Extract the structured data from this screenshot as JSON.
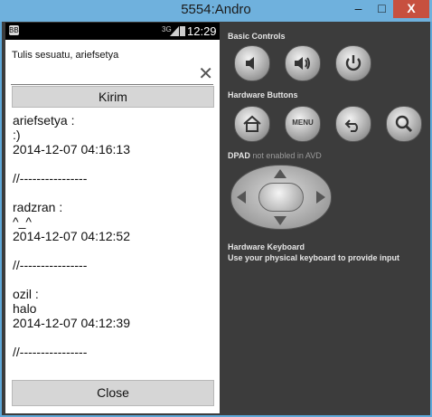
{
  "window": {
    "title": "5554:Andro",
    "minimize_glyph": "–",
    "maximize_glyph": "□",
    "close_glyph": "X"
  },
  "device": {
    "status_icon": "BBM",
    "signal_text": "3G",
    "time": "12:29",
    "prompt": "Tulis sesuatu, ariefsetya",
    "input_value": "",
    "send_label": "Kirim",
    "close_label": "Close",
    "messages": [
      {
        "user": "ariefsetya :",
        "text": ":)",
        "time": "2014-12-07 04:16:13",
        "sep": "//----------------"
      },
      {
        "user": "radzran :",
        "text": "^_^",
        "time": "2014-12-07 04:12:52",
        "sep": "//----------------"
      },
      {
        "user": "ozil :",
        "text": "halo",
        "time": "2014-12-07 04:12:39",
        "sep": "//----------------"
      }
    ]
  },
  "controls": {
    "basic_title": "Basic Controls",
    "hardware_title": "Hardware Buttons",
    "menu_label": "MENU",
    "dpad_title": "DPAD",
    "dpad_note": "not enabled in AVD",
    "keyboard_title": "Hardware Keyboard",
    "keyboard_desc": "Use your physical keyboard to provide input"
  },
  "colors": {
    "titlebar": "#6fb1dd",
    "close": "#c7503f",
    "panel": "#3c3c3c",
    "button": "#d6d6d6"
  },
  "icons": [
    "volume-down-icon",
    "volume-up-icon",
    "power-icon",
    "home-icon",
    "menu-icon",
    "back-icon",
    "search-icon",
    "clear-icon"
  ]
}
